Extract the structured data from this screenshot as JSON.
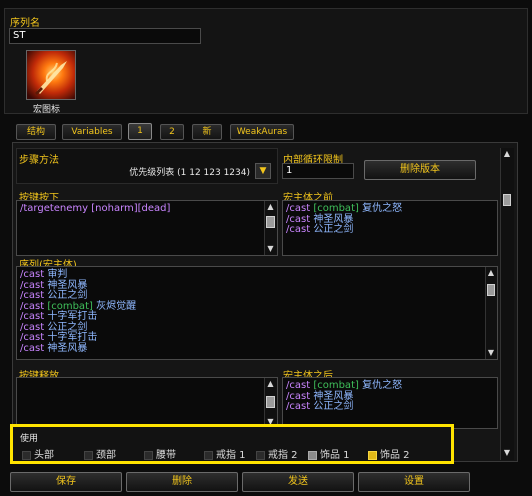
{
  "sequence_name": {
    "label": "序列名",
    "value": "ST"
  },
  "macro_icon": {
    "label": "宏图标"
  },
  "tabs": [
    {
      "label": "结构"
    },
    {
      "label": "Variables"
    },
    {
      "label": "1"
    },
    {
      "label": "2"
    },
    {
      "label": "新"
    },
    {
      "label": "WeakAuras"
    }
  ],
  "step_method": {
    "label": "步骤方法",
    "value": "优先级列表 (1 12 123 1234)"
  },
  "reset_limit": {
    "label": "内部循环限制",
    "value": "1"
  },
  "delete_version": {
    "label": "删除版本"
  },
  "keypress": {
    "label": "按键按下",
    "text": "/targetenemy [noharm][dead]"
  },
  "pre_macro": {
    "label": "宏主体之前",
    "lines": [
      {
        "cmd": "/cast",
        "cond": "[combat]",
        "spell": "复仇之怒"
      },
      {
        "cmd": "/cast",
        "cond": "",
        "spell": "神圣风暴"
      },
      {
        "cmd": "/cast",
        "cond": "",
        "spell": "公正之剑"
      }
    ]
  },
  "sequence_body": {
    "label": "序列(宏主体)",
    "lines": [
      {
        "cmd": "/cast",
        "cond": "",
        "spell": "审判"
      },
      {
        "cmd": "/cast",
        "cond": "",
        "spell": "神圣风暴"
      },
      {
        "cmd": "/cast",
        "cond": "",
        "spell": "公正之剑"
      },
      {
        "cmd": "/cast",
        "cond": "[combat]",
        "spell": "灰烬觉醒"
      },
      {
        "cmd": "/cast",
        "cond": "",
        "spell": "十字军打击"
      },
      {
        "cmd": "/cast",
        "cond": "",
        "spell": "公正之剑"
      },
      {
        "cmd": "/cast",
        "cond": "",
        "spell": "十字军打击"
      },
      {
        "cmd": "/cast",
        "cond": "",
        "spell": "神圣风暴"
      }
    ]
  },
  "keyrelease": {
    "label": "按键释放"
  },
  "post_macro": {
    "label": "宏主体之后",
    "lines": [
      {
        "cmd": "/cast",
        "cond": "[combat]",
        "spell": "复仇之怒"
      },
      {
        "cmd": "/cast",
        "cond": "",
        "spell": "神圣风暴"
      },
      {
        "cmd": "/cast",
        "cond": "",
        "spell": "公正之剑"
      }
    ]
  },
  "use": {
    "label": "使用",
    "items": [
      {
        "label": "头部",
        "state": "off"
      },
      {
        "label": "颈部",
        "state": "off"
      },
      {
        "label": "腰带",
        "state": "off"
      },
      {
        "label": "戒指 1",
        "state": "off"
      },
      {
        "label": "戒指 2",
        "state": "off"
      },
      {
        "label": "饰品 1",
        "state": "gray"
      },
      {
        "label": "饰品 2",
        "state": "yellow"
      }
    ]
  },
  "bottom_buttons": [
    {
      "label": "保存"
    },
    {
      "label": "删除"
    },
    {
      "label": "发送"
    },
    {
      "label": "设置"
    }
  ],
  "colors": {
    "accent_gold": "#f2c51c",
    "highlight_yellow": "#ffe300",
    "spell_blue": "#8fb8ff",
    "cmd_purple": "#c985ff",
    "cond_green": "#3fbf5a"
  }
}
